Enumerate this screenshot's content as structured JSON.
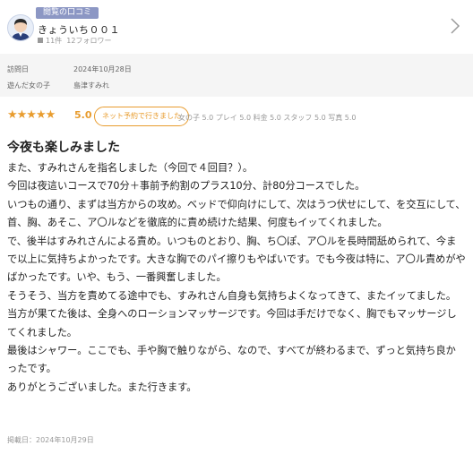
{
  "header": {
    "badge": "閲覧の口コミ",
    "username": "きょういち００１",
    "posts": "11件",
    "follows": "12フォロワー"
  },
  "info": {
    "visit_label": "訪問日",
    "visit_value": "2024年10月28日",
    "girl_label": "遊んだ女の子",
    "girl_value": "島津すみれ"
  },
  "rating": {
    "stars": "★★★★★",
    "score": "5.0",
    "pill": "ネット予約で行きました",
    "subs": "女の子 5.0 プレイ 5.0 料金 5.0 スタッフ 5.0 写真 5.0"
  },
  "review": {
    "title": "今夜も楽しみました",
    "body": "また、すみれさんを指名しました（今回で４回目？）。\n今回は夜這いコースで70分＋事前予約割のプラス10分、計80分コースでした。\nいつもの通り、まずは当方からの攻め。ベッドで仰向けにして、次はうつ伏せにして、を交互にして、首、胸、あそこ、ア〇ルなどを徹底的に責め続けた結果、何度もイッてくれました。\nで、後半はすみれさんによる責め。いつものとおり、胸、ち〇ぽ、ア〇ルを長時間舐められて、今まで以上に気持ちよかったです。大きな胸でのパイ擦りもやばいです。でも今夜は特に、ア〇ル責めがやばかったです。いや、もう、一番興奮しました。\nそうそう、当方を責めてる途中でも、すみれさん自身も気持ちよくなってきて、またイッてました。\n当方が果てた後は、全身へのローションマッサージです。今回は手だけでなく、胸でもマッサージしてくれました。\n最後はシャワー。ここでも、手や胸で触りながら、なので、すべてが終わるまで、ずっと気持ち良かったです。\nありがとうございました。また行きます。",
    "posted": "掲載日：2024年10月29日"
  },
  "colors": {
    "accent": "#e89c2e",
    "badge": "#8c97c4",
    "info_bg": "#f5f5f5"
  }
}
